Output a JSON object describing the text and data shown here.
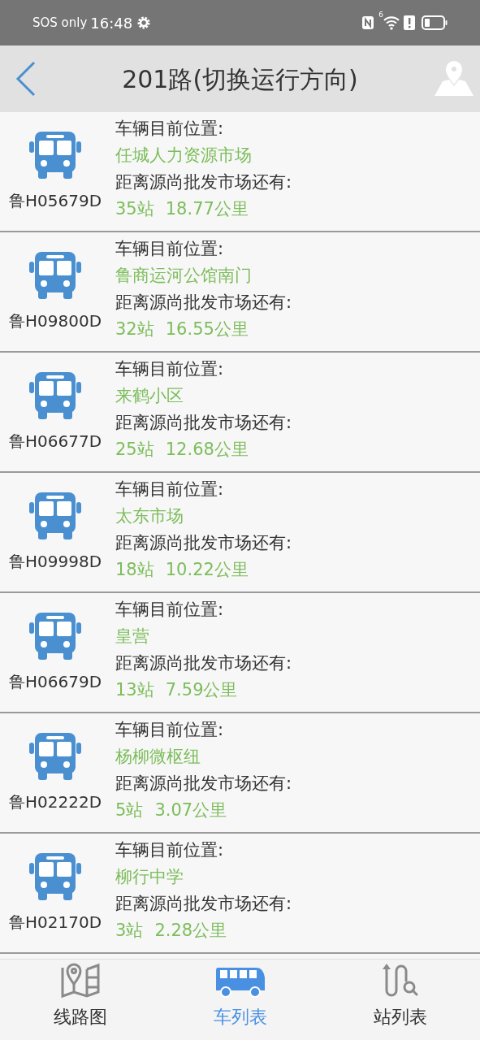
{
  "status_bar": {
    "carrier": "SOS only",
    "time": "16:48",
    "wifi_badge": "6"
  },
  "header": {
    "title": "201路(切换运行方向)"
  },
  "buses": [
    {
      "plate": "鲁H05679D",
      "position_label": "车辆目前位置:",
      "position": "任城人力资源市场",
      "distance_label": "距离源尚批发市场还有:",
      "stops": "35站",
      "km": "18.77公里"
    },
    {
      "plate": "鲁H09800D",
      "position_label": "车辆目前位置:",
      "position": "鲁商运河公馆南门",
      "distance_label": "距离源尚批发市场还有:",
      "stops": "32站",
      "km": "16.55公里"
    },
    {
      "plate": "鲁H06677D",
      "position_label": "车辆目前位置:",
      "position": "来鹤小区",
      "distance_label": "距离源尚批发市场还有:",
      "stops": "25站",
      "km": "12.68公里"
    },
    {
      "plate": "鲁H09998D",
      "position_label": "车辆目前位置:",
      "position": "太东市场",
      "distance_label": "距离源尚批发市场还有:",
      "stops": "18站",
      "km": "10.22公里"
    },
    {
      "plate": "鲁H06679D",
      "position_label": "车辆目前位置:",
      "position": "皇营",
      "distance_label": "距离源尚批发市场还有:",
      "stops": "13站",
      "km": "7.59公里"
    },
    {
      "plate": "鲁H02222D",
      "position_label": "车辆目前位置:",
      "position": "杨柳微枢纽",
      "distance_label": "距离源尚批发市场还有:",
      "stops": "5站",
      "km": "3.07公里"
    },
    {
      "plate": "鲁H02170D",
      "position_label": "车辆目前位置:",
      "position": "柳行中学",
      "distance_label": "距离源尚批发市场还有:",
      "stops": "3站",
      "km": "2.28公里"
    }
  ],
  "tabs": [
    {
      "kind": "map",
      "label": "线路图",
      "selected": false
    },
    {
      "kind": "bus",
      "label": "车列表",
      "selected": true
    },
    {
      "kind": "stops",
      "label": "站列表",
      "selected": false
    }
  ]
}
